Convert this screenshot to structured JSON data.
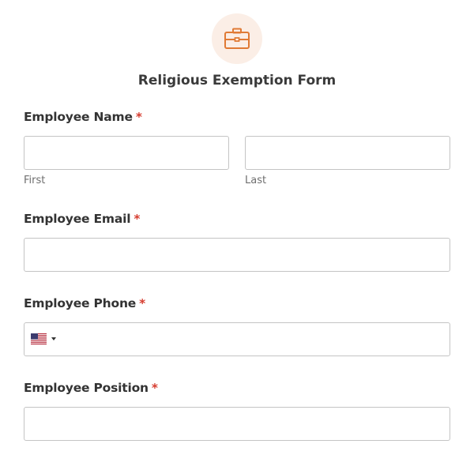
{
  "header": {
    "icon": "briefcase-icon",
    "icon_color": "#e07a35",
    "icon_bg": "#fbeee6",
    "title": "Religious Exemption Form"
  },
  "fields": {
    "name": {
      "label": "Employee Name",
      "required_mark": "*",
      "first_sublabel": "First",
      "last_sublabel": "Last",
      "first_value": "",
      "last_value": ""
    },
    "email": {
      "label": "Employee Email",
      "required_mark": "*",
      "value": ""
    },
    "phone": {
      "label": "Employee Phone",
      "required_mark": "*",
      "country_flag": "us-flag-icon",
      "value": ""
    },
    "position": {
      "label": "Employee Position",
      "required_mark": "*",
      "value": ""
    }
  },
  "colors": {
    "required": "#d63c2f",
    "border": "#c4c4c4",
    "accent": "#e07a35"
  }
}
